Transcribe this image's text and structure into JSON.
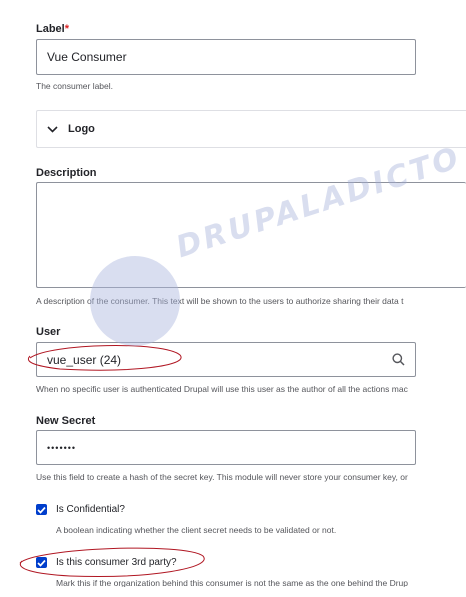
{
  "label_field": {
    "label": "Label",
    "required_mark": "*",
    "value": "Vue Consumer",
    "description": "The consumer label."
  },
  "logo_section": {
    "title": "Logo",
    "icon": "chevron-down-icon"
  },
  "description_field": {
    "label": "Description",
    "value": "",
    "description": "A description of the consumer. This text will be shown to the users to authorize sharing their data t"
  },
  "user_field": {
    "label": "User",
    "value": "vue_user (24)",
    "icon": "search-icon",
    "description": "When no specific user is authenticated Drupal will use this user as the author of all the actions mac"
  },
  "secret_field": {
    "label": "New Secret",
    "value": "•••••••",
    "description": "Use this field to create a hash of the secret key. This module will never store your consumer key, or"
  },
  "confidential_field": {
    "label": "Is Confidential?",
    "checked": true,
    "description": "A boolean indicating whether the client secret needs to be validated or not."
  },
  "third_party_field": {
    "label": "Is this consumer 3rd party?",
    "checked": true,
    "description": "Mark this if the organization behind this consumer is not the same as the one behind the Drup"
  },
  "watermark": {
    "text": "DRUPALADICTO"
  },
  "colors": {
    "accent": "#003ecc",
    "required": "#dc2323",
    "annotation": "#b01622",
    "border": "#8e929c"
  }
}
